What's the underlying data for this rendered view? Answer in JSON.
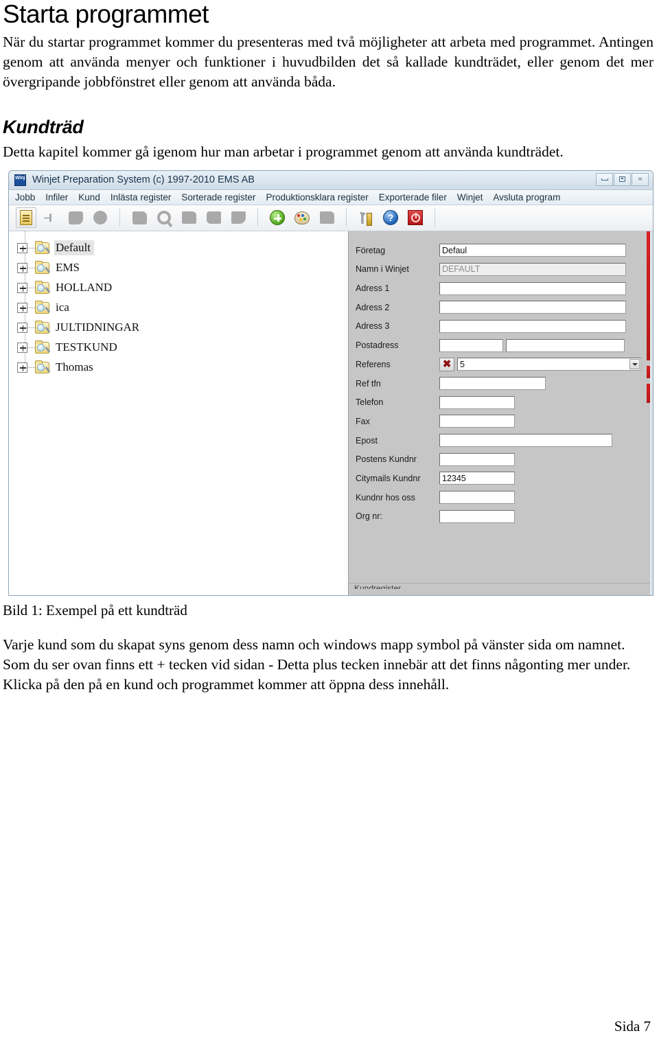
{
  "document": {
    "heading": "Starta programmet",
    "intro_paragraph": "När du startar programmet kommer du presenteras med två  möjligheter att arbeta med programmet. Antingen genom att använda menyer och funktioner i huvudbilden det så kallade kundträdet, eller genom det mer övergripande jobbfönstret eller genom att använda båda.",
    "section_heading": "Kundträd",
    "section_paragraph": "Detta kapitel kommer gå igenom hur man arbetar i programmet genom att använda kundträdet.",
    "figure_caption": "Bild 1: Exempel på ett kundträd",
    "closing_paragraph": "Varje kund som du skapat syns genom dess namn och windows mapp symbol på vänster sida om namnet. Som du ser ovan finns ett + tecken vid sidan - Detta plus tecken innebär att det finns någonting mer under. Klicka på den på en kund och programmet kommer att öppna dess innehåll.",
    "page_footer": "Sida 7"
  },
  "app_window": {
    "icon_label": "Winjet",
    "title": "Winjet Preparation System (c) 1997-2010 EMS AB",
    "window_controls": {
      "minimize": "minimize-icon",
      "maximize": "maximize-icon",
      "close": "≈"
    },
    "menu_items": [
      "Jobb",
      "Infiler",
      "Kund",
      "Inlästa register",
      "Sorterade register",
      "Produktionsklara register",
      "Exporterade filer",
      "Winjet",
      "Avsluta program"
    ],
    "toolbar_icons": [
      "document-icon",
      "pin-icon",
      "disk-icon",
      "circle-icon",
      "bag-icon",
      "magnifier-icon",
      "folder-icon",
      "folder-stack-icon",
      "folder-tag-icon",
      "add-icon",
      "palette-icon",
      "folder-gray-icon",
      "tools-icon",
      "help-icon",
      "stop-icon"
    ],
    "help_glyph": "?",
    "tree": {
      "nodes": [
        {
          "label": "Default",
          "selected": true
        },
        {
          "label": "EMS",
          "selected": false
        },
        {
          "label": "HOLLAND",
          "selected": false
        },
        {
          "label": "ica",
          "selected": false
        },
        {
          "label": "JULTIDNINGAR",
          "selected": false
        },
        {
          "label": "TESTKUND",
          "selected": false
        },
        {
          "label": "Thomas",
          "selected": false
        }
      ],
      "expander_glyph": "+"
    },
    "form": {
      "fields": [
        {
          "label": "Företag",
          "value": "Defaul",
          "type": "text",
          "width": "w-long",
          "readonly": false
        },
        {
          "label": "Namn i Winjet",
          "value": "DEFAULT",
          "type": "text",
          "width": "w-long",
          "readonly": true
        },
        {
          "label": "Adress 1",
          "value": "",
          "type": "text",
          "width": "w-long",
          "readonly": false
        },
        {
          "label": "Adress 2",
          "value": "",
          "type": "text",
          "width": "w-long",
          "readonly": false
        },
        {
          "label": "Adress 3",
          "value": "",
          "type": "text",
          "width": "w-long",
          "readonly": false
        },
        {
          "label": "Postadress",
          "value": "",
          "type": "zip",
          "width": "w-zip1",
          "readonly": false,
          "value2": ""
        },
        {
          "label": "Referens",
          "value": "5",
          "type": "combo",
          "width": "w-long",
          "readonly": false,
          "clear_button": "✖"
        },
        {
          "label": "Ref tfn",
          "value": "",
          "type": "text",
          "width": "w-med",
          "readonly": false
        },
        {
          "label": "Telefon",
          "value": "",
          "type": "text",
          "width": "w-short",
          "readonly": false
        },
        {
          "label": "Fax",
          "value": "",
          "type": "text",
          "width": "w-short",
          "readonly": false
        },
        {
          "label": "Epost",
          "value": "",
          "type": "text",
          "width": "w-email",
          "readonly": false
        },
        {
          "label": "Postens Kundnr",
          "value": "",
          "type": "text",
          "width": "w-short",
          "readonly": false
        },
        {
          "label": "Citymails Kundnr",
          "value": "12345",
          "type": "text",
          "width": "w-short",
          "readonly": false
        },
        {
          "label": "Kundnr hos oss",
          "value": "",
          "type": "text",
          "width": "w-short",
          "readonly": false
        },
        {
          "label": "Org nr:",
          "value": "",
          "type": "text",
          "width": "w-short",
          "readonly": false
        }
      ]
    },
    "status_text": "Kundregister"
  },
  "colors": {
    "titlebar": "#d6dde5",
    "form_panel": "#c6c6c6",
    "accent_red": "#b50e0e",
    "folder_yellow": "#efd87e",
    "selection": "#e4e4e4"
  }
}
